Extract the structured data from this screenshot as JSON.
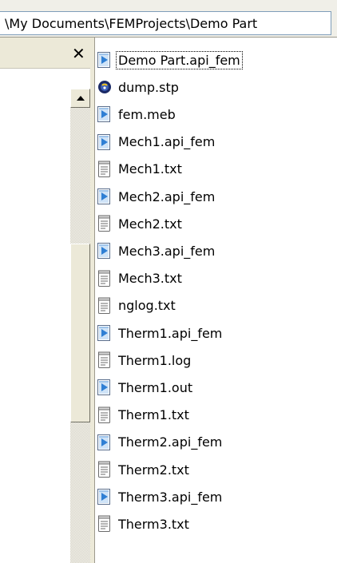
{
  "address_bar": {
    "path": "\\My Documents\\FEMProjects\\Demo Part"
  },
  "left_pane": {
    "close_glyph": "✕"
  },
  "files": [
    {
      "name": "Demo Part.api_fem",
      "icon": "api-fem-file-icon"
    },
    {
      "name": "dump.stp",
      "icon": "stp-file-icon"
    },
    {
      "name": "fem.meb",
      "icon": "api-fem-file-icon"
    },
    {
      "name": "Mech1.api_fem",
      "icon": "api-fem-file-icon"
    },
    {
      "name": "Mech1.txt",
      "icon": "text-file-icon"
    },
    {
      "name": "Mech2.api_fem",
      "icon": "api-fem-file-icon"
    },
    {
      "name": "Mech2.txt",
      "icon": "text-file-icon"
    },
    {
      "name": "Mech3.api_fem",
      "icon": "api-fem-file-icon"
    },
    {
      "name": "Mech3.txt",
      "icon": "text-file-icon"
    },
    {
      "name": "nglog.txt",
      "icon": "text-file-icon"
    },
    {
      "name": "Therm1.api_fem",
      "icon": "api-fem-file-icon"
    },
    {
      "name": "Therm1.log",
      "icon": "text-file-icon"
    },
    {
      "name": "Therm1.out",
      "icon": "api-fem-file-icon"
    },
    {
      "name": "Therm1.txt",
      "icon": "text-file-icon"
    },
    {
      "name": "Therm2.api_fem",
      "icon": "api-fem-file-icon"
    },
    {
      "name": "Therm2.txt",
      "icon": "text-file-icon"
    },
    {
      "name": "Therm3.api_fem",
      "icon": "api-fem-file-icon"
    },
    {
      "name": "Therm3.txt",
      "icon": "text-file-icon"
    }
  ],
  "focused_index": 0
}
